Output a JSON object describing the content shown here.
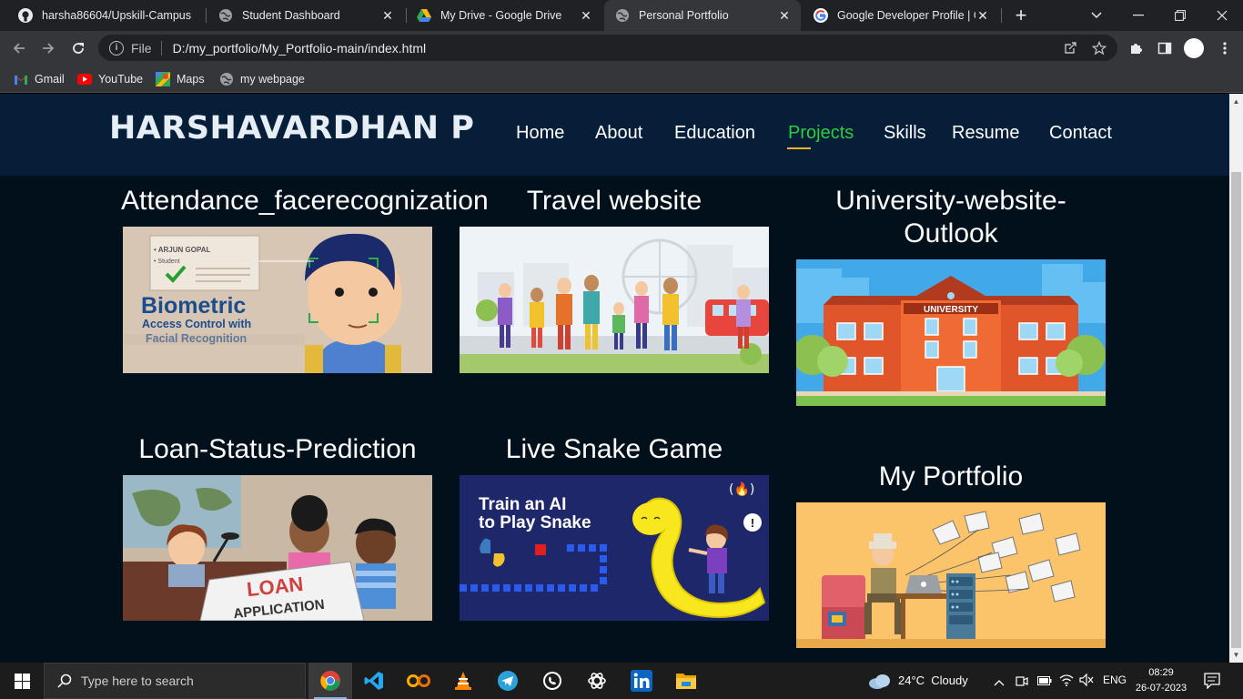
{
  "browser": {
    "tabs": [
      {
        "title": "harsha86604/Upskill-Campus",
        "icon": "github-icon"
      },
      {
        "title": "Student Dashboard",
        "icon": "globe-icon"
      },
      {
        "title": "My Drive - Google Drive",
        "icon": "google-drive-icon"
      },
      {
        "title": "Personal Portfolio",
        "icon": "globe-icon",
        "active": true
      },
      {
        "title": "Google Developer Profile | G",
        "icon": "google-icon"
      }
    ],
    "address": {
      "scheme_label": "File",
      "url": "D:/my_portfolio/My_Portfolio-main/index.html"
    },
    "bookmarks": [
      {
        "label": "Gmail",
        "icon": "gmail-icon"
      },
      {
        "label": "YouTube",
        "icon": "youtube-icon"
      },
      {
        "label": "Maps",
        "icon": "maps-icon"
      },
      {
        "label": "my webpage",
        "icon": "globe-icon"
      }
    ]
  },
  "site": {
    "brand": "HARSHAVARDHAN P",
    "nav": [
      {
        "label": "Home"
      },
      {
        "label": "About"
      },
      {
        "label": "Education"
      },
      {
        "label": "Projects",
        "active": true
      },
      {
        "label": "Skills"
      },
      {
        "label": "Resume"
      },
      {
        "label": "Contact"
      }
    ],
    "projects": [
      {
        "title": "Attendance_facerecognization",
        "image_text": [
          "• ARJUN GOPAL",
          "• Student",
          "Biometric",
          "Access Control with",
          "Facial Recognition"
        ]
      },
      {
        "title": "Travel website"
      },
      {
        "title": "University-website-Outlook",
        "image_text": [
          "UNIVERSITY"
        ]
      },
      {
        "title": "Loan-Status-Prediction",
        "image_text": [
          "LOAN",
          "APPLICATION"
        ]
      },
      {
        "title": "Live Snake Game",
        "image_text": [
          "Train an AI",
          "to Play Snake",
          "(🔥)"
        ]
      },
      {
        "title": "My Portfolio"
      }
    ]
  },
  "taskbar": {
    "search_placeholder": "Type here to search",
    "weather": "24°C  Cloudy",
    "language": "ENG",
    "time": "08:29",
    "date": "26-07-2023"
  },
  "colors": {
    "page_bg": "#02101c",
    "header_bg": "#061e38",
    "nav_active": "#2ecc40",
    "underline": "#f0b429"
  }
}
